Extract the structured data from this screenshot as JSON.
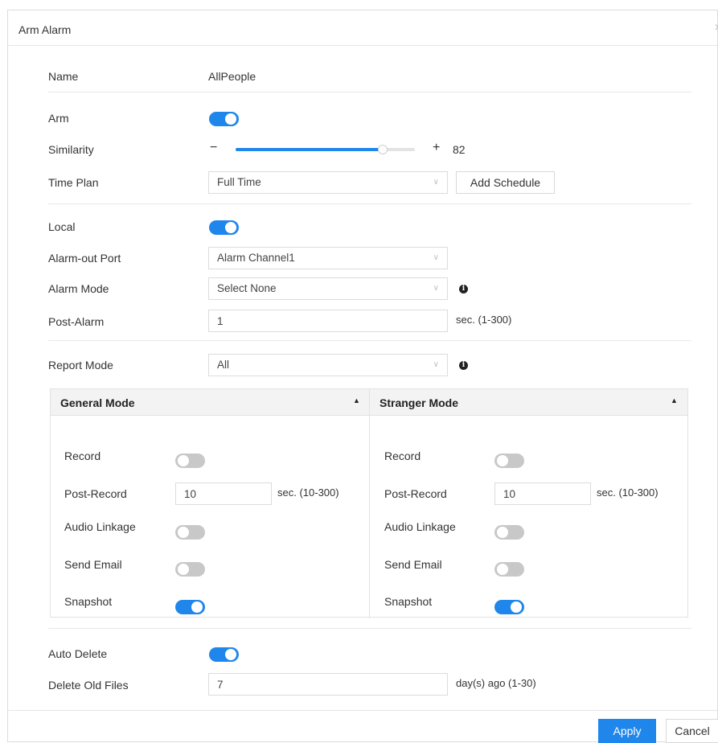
{
  "dialog": {
    "title": "Arm Alarm",
    "close_glyph": "×"
  },
  "name": {
    "label": "Name",
    "value": "AllPeople"
  },
  "arm": {
    "label": "Arm",
    "on": true
  },
  "similarity": {
    "label": "Similarity",
    "minus": "−",
    "plus": "+",
    "value": "82",
    "level_percent": 82
  },
  "time_plan": {
    "label": "Time Plan",
    "selected": "Full Time",
    "add_button": "Add Schedule"
  },
  "local": {
    "label": "Local",
    "on": true
  },
  "alarm_out_port": {
    "label": "Alarm-out Port",
    "selected": "Alarm Channel1"
  },
  "alarm_mode": {
    "label": "Alarm Mode",
    "selected": "Select None"
  },
  "post_alarm": {
    "label": "Post-Alarm",
    "value": "1",
    "unit": "sec. (1-300)"
  },
  "report_mode": {
    "label": "Report Mode",
    "selected": "All"
  },
  "general_mode": {
    "title": "General Mode",
    "record_label": "Record",
    "record_on": false,
    "post_record_label": "Post-Record",
    "post_record_value": "10",
    "post_record_unit": "sec. (10-300)",
    "audio_label": "Audio Linkage",
    "audio_on": false,
    "email_label": "Send Email",
    "email_on": false,
    "snapshot_label": "Snapshot",
    "snapshot_on": true
  },
  "stranger_mode": {
    "title": "Stranger Mode",
    "record_label": "Record",
    "record_on": false,
    "post_record_label": "Post-Record",
    "post_record_value": "10",
    "post_record_unit": "sec. (10-300)",
    "audio_label": "Audio Linkage",
    "audio_on": false,
    "email_label": "Send Email",
    "email_on": false,
    "snapshot_label": "Snapshot",
    "snapshot_on": true
  },
  "auto_delete": {
    "label": "Auto Delete",
    "on": true
  },
  "delete_old_files": {
    "label": "Delete Old Files",
    "value": "7",
    "unit": "day(s) ago (1-30)"
  },
  "footer": {
    "apply": "Apply",
    "cancel": "Cancel"
  },
  "icons": {
    "info": "i",
    "caret": "∨",
    "chevron_up": "▲"
  },
  "colors": {
    "accent": "#1f86ec",
    "toggle_off": "#c8c8c8"
  }
}
